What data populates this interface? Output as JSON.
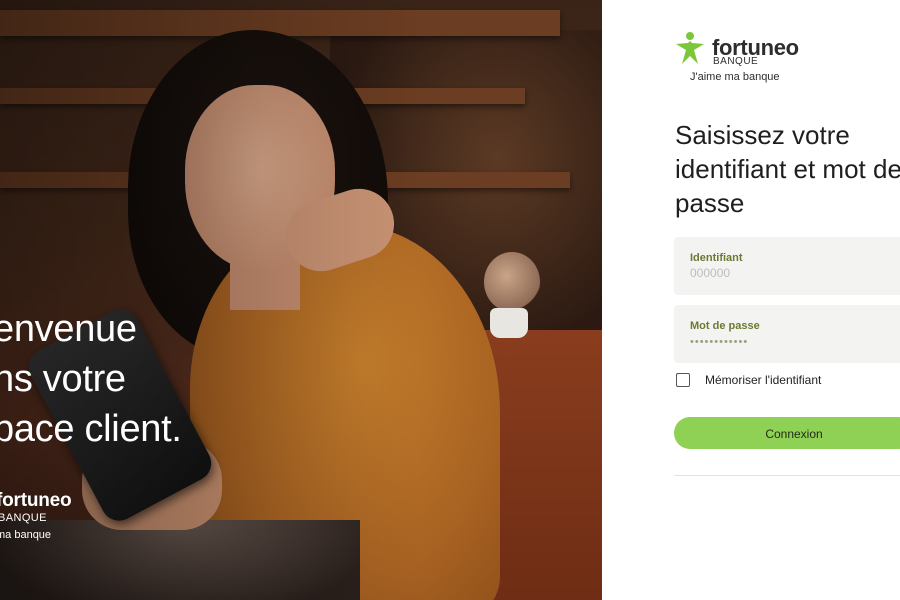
{
  "hero": {
    "title_lines": [
      "envenue",
      "ns votre",
      "pace client."
    ],
    "logo": {
      "brand": "fortuneo",
      "sub": "BANQUE",
      "tagline": "ma banque"
    }
  },
  "login": {
    "logo": {
      "brand": "fortuneo",
      "sub": "BANQUE",
      "tagline": "J'aime ma banque"
    },
    "title": "Saisissez votre identifiant et mot de passe",
    "identifier": {
      "label": "Identifiant",
      "placeholder": "000000",
      "value": ""
    },
    "password": {
      "label": "Mot de passe",
      "masked_value": "••••••••••••"
    },
    "remember": {
      "label": "Mémoriser l'identifiant",
      "checked": false
    },
    "submit_label": "Connexion"
  },
  "colors": {
    "brand_green": "#8fd155",
    "logo_green": "#7cc63a",
    "label_olive": "#6a7a33",
    "field_bg": "#f3f4f2"
  },
  "icons": {
    "logo": "star-person-icon"
  }
}
